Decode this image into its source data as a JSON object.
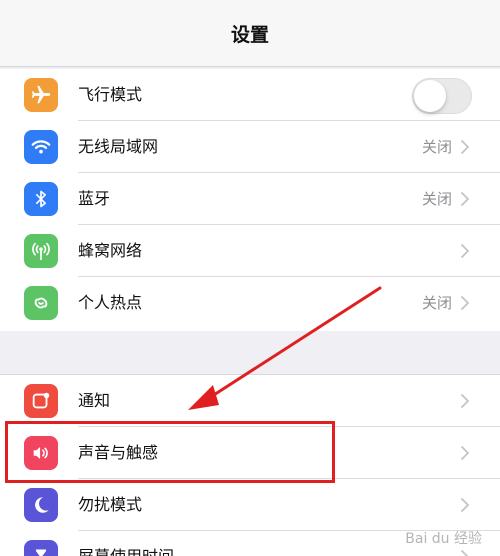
{
  "nav": {
    "title": "设置"
  },
  "group1": [
    {
      "label": "飞行模式",
      "icon": "airplane-icon",
      "color": "#f29d38",
      "accessory": "toggle",
      "toggle_on": false
    },
    {
      "label": "无线局域网",
      "icon": "wifi-icon",
      "color": "#2f7cf6",
      "value": "关闭"
    },
    {
      "label": "蓝牙",
      "icon": "bluetooth-icon",
      "color": "#2f7cf6",
      "value": "关闭"
    },
    {
      "label": "蜂窝网络",
      "icon": "cellular-icon",
      "color": "#5dc466",
      "value": ""
    },
    {
      "label": "个人热点",
      "icon": "hotspot-icon",
      "color": "#5dc466",
      "value": "关闭"
    }
  ],
  "group2": [
    {
      "label": "通知",
      "icon": "notifications-icon",
      "color": "#f04b3f"
    },
    {
      "label": "声音与触感",
      "icon": "sound-icon",
      "color": "#f0445f"
    },
    {
      "label": "勿扰模式",
      "icon": "moon-icon",
      "color": "#5a55d6"
    },
    {
      "label": "屏幕使用时间",
      "icon": "hourglass-icon",
      "color": "#5a55d6"
    }
  ],
  "annotation": {
    "highlighted_row": "声音与触感",
    "arrow_color": "#e02020"
  },
  "watermark": "Bai du 经验"
}
